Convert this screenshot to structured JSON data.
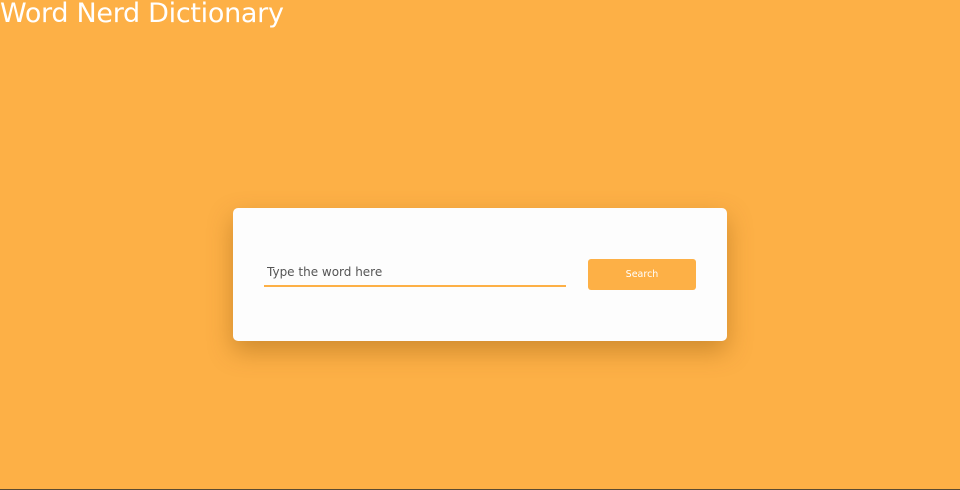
{
  "app": {
    "title": "Word Nerd Dictionary"
  },
  "search": {
    "value": "",
    "placeholder": "Type the word here",
    "button_label": "Search"
  },
  "colors": {
    "background": "#fdb046",
    "card": "#fdfdfd",
    "accent": "#fdb046",
    "title_text": "#ffffff",
    "button_text": "#ffffff"
  }
}
